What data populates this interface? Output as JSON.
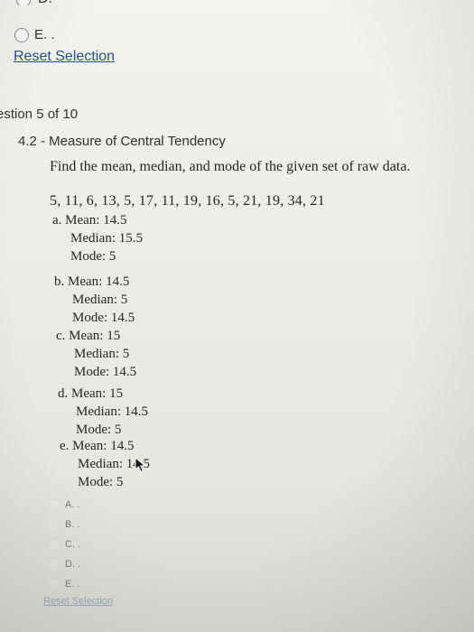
{
  "previous_question": {
    "options": [
      {
        "label": "D."
      },
      {
        "label": "E. ."
      }
    ],
    "reset_label": "Reset Selection"
  },
  "question": {
    "header": "estion 5 of 10",
    "topic": "4.2 - Measure of Central Tendency",
    "prompt": "Find the mean, median, and mode of the given set of raw data.",
    "dataset": "5, 11, 6, 13, 5, 17, 11, 19, 16, 5, 21, 19, 34, 21",
    "choices": [
      {
        "mean": "a. Mean: 14.5",
        "median": "Median: 15.5",
        "mode": "Mode: 5"
      },
      {
        "mean": "b. Mean: 14.5",
        "median": "Median: 5",
        "mode": "Mode: 14.5"
      },
      {
        "mean": "c. Mean: 15",
        "median": "Median: 5",
        "mode": "Mode: 14.5"
      },
      {
        "mean": "d. Mean: 15",
        "median": "Median: 14.5",
        "mode": "Mode: 5"
      },
      {
        "mean": "e. Mean: 14.5",
        "median": "Median: 14.5",
        "mode": "Mode: 5"
      }
    ]
  },
  "answer_options": [
    {
      "label": "A. ."
    },
    {
      "label": "B. ."
    },
    {
      "label": "C. ."
    },
    {
      "label": "D. ."
    },
    {
      "label": "E. ."
    }
  ],
  "reset_label": "Reset Selection"
}
